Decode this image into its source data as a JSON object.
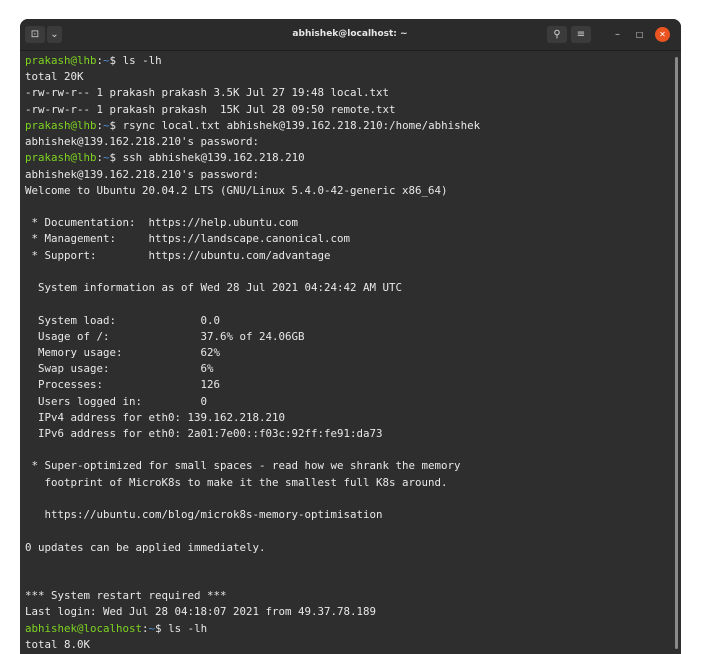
{
  "window": {
    "title": "abhishek@localhost: ~",
    "buttons": {
      "new_tab_icon": "⊡",
      "tab_menu_icon": "⌄",
      "search_icon": "⚲",
      "menu_icon": "≡",
      "minimize_icon": "–",
      "maximize_icon": "□",
      "close_icon": "✕"
    }
  },
  "colors": {
    "prompt_user": "#7ed321",
    "prompt_path": "#4f8fd6",
    "close_button": "#e95420",
    "terminal_bg": "#2e2e2e",
    "text": "#e9e9e9"
  },
  "terminal": {
    "lines": [
      {
        "prompt": {
          "user": "prakash@lhb",
          "sep": ":",
          "path": "~",
          "sym": "$ "
        },
        "text": "ls -lh"
      },
      {
        "text": "total 20K"
      },
      {
        "text": "-rw-rw-r-- 1 prakash prakash 3.5K Jul 27 19:48 local.txt"
      },
      {
        "text": "-rw-rw-r-- 1 prakash prakash  15K Jul 28 09:50 remote.txt"
      },
      {
        "prompt": {
          "user": "prakash@lhb",
          "sep": ":",
          "path": "~",
          "sym": "$ "
        },
        "text": "rsync local.txt abhishek@139.162.218.210:/home/abhishek"
      },
      {
        "text": "abhishek@139.162.218.210's password:"
      },
      {
        "prompt": {
          "user": "prakash@lhb",
          "sep": ":",
          "path": "~",
          "sym": "$ "
        },
        "text": "ssh abhishek@139.162.218.210"
      },
      {
        "text": "abhishek@139.162.218.210's password:"
      },
      {
        "text": "Welcome to Ubuntu 20.04.2 LTS (GNU/Linux 5.4.0-42-generic x86_64)"
      },
      {
        "text": ""
      },
      {
        "text": " * Documentation:  https://help.ubuntu.com"
      },
      {
        "text": " * Management:     https://landscape.canonical.com"
      },
      {
        "text": " * Support:        https://ubuntu.com/advantage"
      },
      {
        "text": ""
      },
      {
        "text": "  System information as of Wed 28 Jul 2021 04:24:42 AM UTC"
      },
      {
        "text": ""
      },
      {
        "text": "  System load:             0.0"
      },
      {
        "text": "  Usage of /:              37.6% of 24.06GB"
      },
      {
        "text": "  Memory usage:            62%"
      },
      {
        "text": "  Swap usage:              6%"
      },
      {
        "text": "  Processes:               126"
      },
      {
        "text": "  Users logged in:         0"
      },
      {
        "text": "  IPv4 address for eth0: 139.162.218.210"
      },
      {
        "text": "  IPv6 address for eth0: 2a01:7e00::f03c:92ff:fe91:da73"
      },
      {
        "text": ""
      },
      {
        "text": " * Super-optimized for small spaces - read how we shrank the memory"
      },
      {
        "text": "   footprint of MicroK8s to make it the smallest full K8s around."
      },
      {
        "text": ""
      },
      {
        "text": "   https://ubuntu.com/blog/microk8s-memory-optimisation"
      },
      {
        "text": ""
      },
      {
        "text": "0 updates can be applied immediately."
      },
      {
        "text": ""
      },
      {
        "text": ""
      },
      {
        "text": "*** System restart required ***"
      },
      {
        "text": "Last login: Wed Jul 28 04:18:07 2021 from 49.37.78.189"
      },
      {
        "prompt": {
          "user": "abhishek@localhost",
          "sep": ":",
          "path": "~",
          "sym": "$ "
        },
        "text": "ls -lh"
      },
      {
        "text": "total 8.0K"
      }
    ]
  }
}
